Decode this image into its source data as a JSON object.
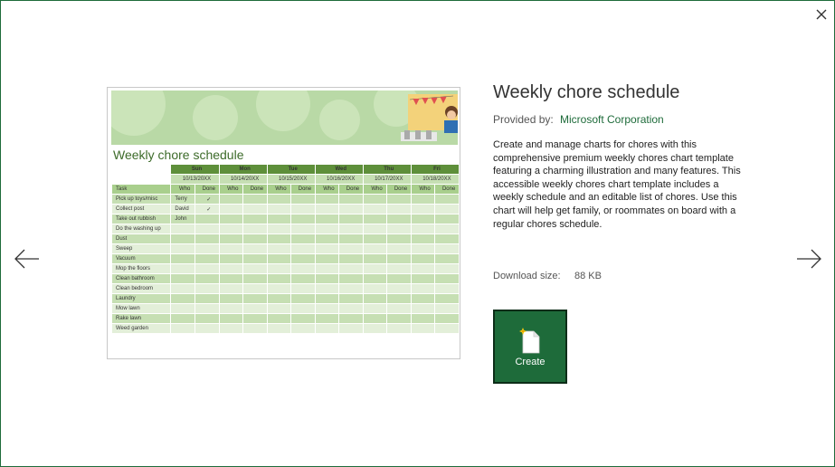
{
  "dialog": {
    "close_icon": "close-icon",
    "prev_icon": "arrow-left-icon",
    "next_icon": "arrow-right-icon"
  },
  "template": {
    "title": "Weekly chore schedule",
    "provided_by_label": "Provided by:",
    "provider": "Microsoft Corporation",
    "description": "Create and manage charts for chores with this comprehensive premium weekly chores chart template featuring a charming illustration and many features. This accessible weekly chores chart template includes a weekly schedule and an editable list of chores. Use this chart will help get family, or roommates on board with a regular chores schedule.",
    "download_size_label": "Download size:",
    "download_size_value": "88 KB",
    "create_label": "Create"
  },
  "preview": {
    "title": "Weekly chore schedule",
    "days": [
      "Sun",
      "Mon",
      "Tue",
      "Wed",
      "Thu",
      "Fri"
    ],
    "dates": [
      "10/13/20XX",
      "10/14/20XX",
      "10/15/20XX",
      "10/16/20XX",
      "10/17/20XX",
      "10/18/20XX"
    ],
    "task_header": "Task",
    "who_label": "Who",
    "done_label": "Done",
    "rows": [
      {
        "task": "Pick up toys/misc",
        "who": "Terry",
        "done": "✓"
      },
      {
        "task": "Collect post",
        "who": "David",
        "done": "✓"
      },
      {
        "task": "Take out rubbish",
        "who": "John",
        "done": ""
      },
      {
        "task": "Do the washing up",
        "who": "",
        "done": ""
      },
      {
        "task": "Dust",
        "who": "",
        "done": ""
      },
      {
        "task": "Sweep",
        "who": "",
        "done": ""
      },
      {
        "task": "Vacuum",
        "who": "",
        "done": ""
      },
      {
        "task": "Mop the floors",
        "who": "",
        "done": ""
      },
      {
        "task": "Clean bathroom",
        "who": "",
        "done": ""
      },
      {
        "task": "Clean bedroom",
        "who": "",
        "done": ""
      },
      {
        "task": "Laundry",
        "who": "",
        "done": ""
      },
      {
        "task": "Mow lawn",
        "who": "",
        "done": ""
      },
      {
        "task": "Rake lawn",
        "who": "",
        "done": ""
      },
      {
        "task": "Weed garden",
        "who": "",
        "done": ""
      }
    ]
  },
  "colors": {
    "accent": "#1e6b3a",
    "header_green": "#5e8f3a",
    "light_green": "#c6dfb3"
  }
}
